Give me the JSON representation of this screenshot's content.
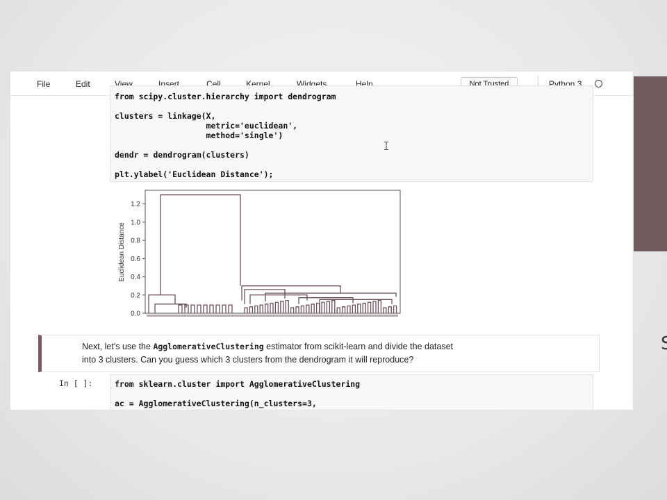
{
  "menubar": {
    "items": [
      "File",
      "Edit",
      "View",
      "Insert",
      "Cell",
      "Kernel",
      "Widgets",
      "Help"
    ],
    "trust_label": "Not Trusted",
    "kernel_name": "Python 3"
  },
  "cells": {
    "code1_lines": [
      "from scipy.cluster.hierarchy import dendrogram",
      "",
      "clusters = linkage(X,",
      "                   metric='euclidean',",
      "                   method='single')",
      "",
      "dendr = dendrogram(clusters)",
      "",
      "plt.ylabel('Euclidean Distance');"
    ],
    "markdown_line1_prefix": "Next, let's use the ",
    "markdown_code": "AgglomerativeClustering",
    "markdown_line1_suffix": " estimator from scikit-learn and divide the dataset",
    "markdown_line2": "into 3 clusters. Can you guess which 3 clusters from the dendrogram it will reproduce?",
    "code2_prompt": "In [ ]:",
    "code2_lines": [
      "from sklearn.cluster import AgglomerativeClustering",
      "",
      "ac = AgglomerativeClustering(n_clusters=3,"
    ]
  },
  "chart_data": {
    "type": "dendrogram",
    "ylabel": "Euclidean Distance",
    "yticks": [
      "0.0",
      "0.2",
      "0.4",
      "0.6",
      "0.8",
      "1.0",
      "1.2"
    ],
    "ylim": [
      0,
      1.35
    ],
    "root_merge_height": 1.3,
    "cluster_merge_heights": [
      0.2,
      0.3
    ],
    "grid": false
  },
  "colors": {
    "side_panel": "#705b5f",
    "markdown_border": "#7a5a64",
    "dendrogram_color": "#6b5158"
  }
}
